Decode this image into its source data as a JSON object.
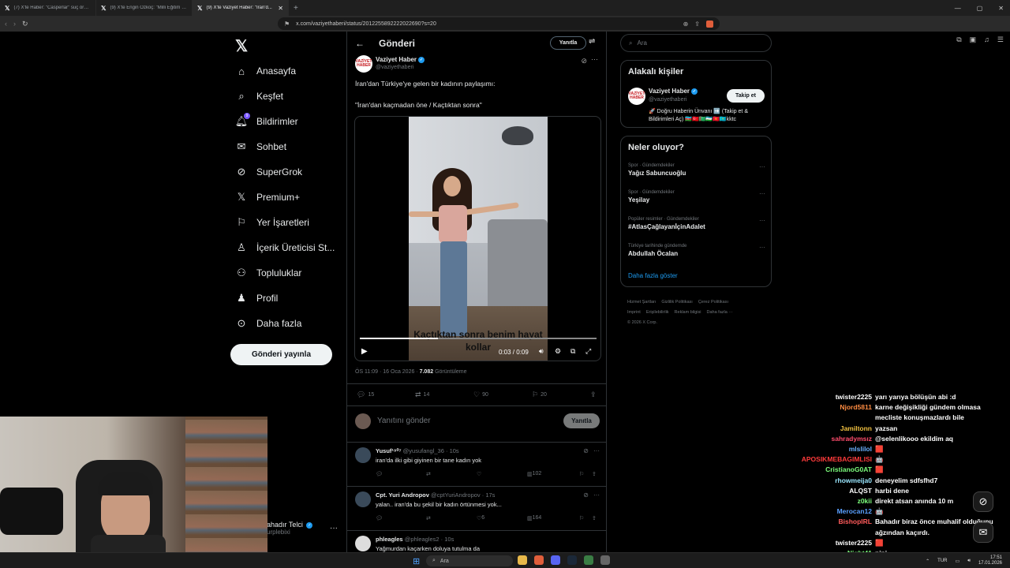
{
  "browser": {
    "tabs": [
      {
        "title": "(7) X'te Haber: \"Casperlar\" suç örgüt...",
        "active": false
      },
      {
        "title": "(9) X'te Engin Özkoç: \"Milli Eğitim Ba...",
        "active": false
      },
      {
        "title": "(9) X'te Vaziyet Haber: \"İran'd...",
        "active": true
      }
    ],
    "url": "x.com/vaziyethaberi/status/2012255892222022690?s=20"
  },
  "nav": {
    "items": [
      {
        "label": "Anasayfa",
        "icon": "home-icon"
      },
      {
        "label": "Keşfet",
        "icon": "search-icon"
      },
      {
        "label": "Bildirimler",
        "icon": "bell-icon",
        "badge": "9"
      },
      {
        "label": "Sohbet",
        "icon": "mail-icon"
      },
      {
        "label": "SuperGrok",
        "icon": "grok-icon"
      },
      {
        "label": "Premium+",
        "icon": "x-icon"
      },
      {
        "label": "Yer İşaretleri",
        "icon": "bookmark-icon"
      },
      {
        "label": "İçerik Üreticisi St...",
        "icon": "creator-studio-icon"
      },
      {
        "label": "Topluluklar",
        "icon": "communities-icon"
      },
      {
        "label": "Profil",
        "icon": "profile-icon"
      },
      {
        "label": "Daha fazla",
        "icon": "more-circle-icon"
      }
    ],
    "post_button": "Gönderi yayınla",
    "user": {
      "name": "ahadır Telci",
      "handle": "urplebixi"
    }
  },
  "main": {
    "title": "Gönderi",
    "reply_pill": "Yanıtla",
    "author": {
      "name": "Vaziyet Haber",
      "handle": "@vaziyethaberi",
      "avatar_text": "VAZİYET HABER"
    },
    "text1": "İran'dan Türkiye'ye gelen bir kadının paylaşımı:",
    "text2": "\"İran'dan kaçmadan öne / Kaçtıktan sonra\"",
    "video": {
      "caption": "Kaçtıktan sonra benim hayat kollar",
      "time": "0:03 / 0:09",
      "progress": 0.33
    },
    "meta": {
      "time": "ÖS 11:09 · 16 Oca 2026 · ",
      "views": "7.082",
      "views_label": " Görüntüleme"
    },
    "stats": {
      "replies": "15",
      "reposts": "14",
      "likes": "90",
      "bookmarks": "20"
    },
    "composer": {
      "placeholder": "Yanıtını gönder",
      "button": "Yanıtla"
    },
    "replies": [
      {
        "name": "Yusuf¹⁹⁰⁷",
        "handle": "@yusufangl_36 · 10s",
        "text": "iran'da ilki gibi giyinen bir tane kadın yok",
        "likes": "",
        "views": "102"
      },
      {
        "name": "Cpt. Yuri Andropov",
        "handle": "@cptYuriAndropov · 17s",
        "text": "yalan.. iran'da bu şekil bir kadın örtünmesi yok...",
        "likes": "6",
        "views": "164"
      },
      {
        "name": "phleagles",
        "handle": "@phleagles2 · 10s",
        "text": "Yağmurdan kaçarken doluya tutulma da",
        "likes": "",
        "views": ""
      }
    ]
  },
  "right": {
    "search_placeholder": "Ara",
    "related_title": "Alakalı kişiler",
    "related": {
      "name": "Vaziyet Haber",
      "handle": "@vaziyethaberi",
      "follow": "Takip et",
      "bio": "🚀 Doğru Haberin Ünvanı ➡️ (Takip et & Bildirimleri Aç) 🇦🇿🇹🇷🇹🇲🇺🇿🇰🇬🇰🇿kktc"
    },
    "trends_title": "Neler oluyor?",
    "trends": [
      {
        "cat": "Spor · Gündemdekiler",
        "name": "Yağız Sabuncuoğlu"
      },
      {
        "cat": "Spor · Gündemdekiler",
        "name": "Yeşilay"
      },
      {
        "cat": "Popüler resimler · Gündemdekiler",
        "name": "#AtlasÇağlayanİçinAdalet"
      },
      {
        "cat": "Türkiye tarihinde gündemde",
        "name": "Abdullah Öcalan"
      }
    ],
    "show_more": "Daha fazla göster",
    "footer": [
      "Hizmet Şartları",
      "Gizlilik Politikası",
      "Çerez Politikası",
      "Imprint",
      "Erişilebilirlik",
      "Reklam bilgisi",
      "Daha fazla ···",
      "© 2026 X Corp."
    ]
  },
  "chat": [
    {
      "user": "twister2225",
      "color": "#ffffff",
      "msg": "yarı yarıya bölüşün abi :d"
    },
    {
      "user": "Njord5811",
      "color": "#ff8c42",
      "msg": "karne değişikliği gündem olmasa"
    },
    {
      "user": "",
      "color": "#ffffff",
      "msg": "mecliste konuşmazlardı bile"
    },
    {
      "user": "Jamiltonn",
      "color": "#f0c040",
      "msg": "yazsan"
    },
    {
      "user": "sahradymsız",
      "color": "#ff4d6d",
      "msg": "@selenlikooo ekildim aq"
    },
    {
      "user": "mlslilol",
      "color": "#6ab0ff",
      "msg": "🟥"
    },
    {
      "user": "APOSIKMEBAGIMLISI",
      "color": "#ff3b3b",
      "msg": "🤖"
    },
    {
      "user": "CristianoG0AT",
      "color": "#7dff7d",
      "msg": "🟥"
    },
    {
      "user": "rhowmeija0",
      "color": "#9be7ff",
      "msg": "deneyelim sdfsfhd7"
    },
    {
      "user": "ALQST",
      "color": "#ffffff",
      "msg": "harbi dene"
    },
    {
      "user": "z0kii",
      "color": "#7dff7d",
      "msg": "direkt atsan anında 10 m"
    },
    {
      "user": "Merocan12",
      "color": "#5aa0ff",
      "msg": "🤖"
    },
    {
      "user": "BishopIRL",
      "color": "#ff5b5b",
      "msg": "Bahadır biraz önce muhalif olduğunu"
    },
    {
      "user": "",
      "color": "#ffffff",
      "msg": "ağzından kaçırdı."
    },
    {
      "user": "twister2225",
      "color": "#ffffff",
      "msg": "🟥"
    },
    {
      "user": "Night41",
      "color": "#7dff7d",
      "msg": "pipi"
    }
  ],
  "taskbar": {
    "search": "Ara",
    "lang": "TUR",
    "time": "17:51",
    "date": "17.01.2026"
  }
}
